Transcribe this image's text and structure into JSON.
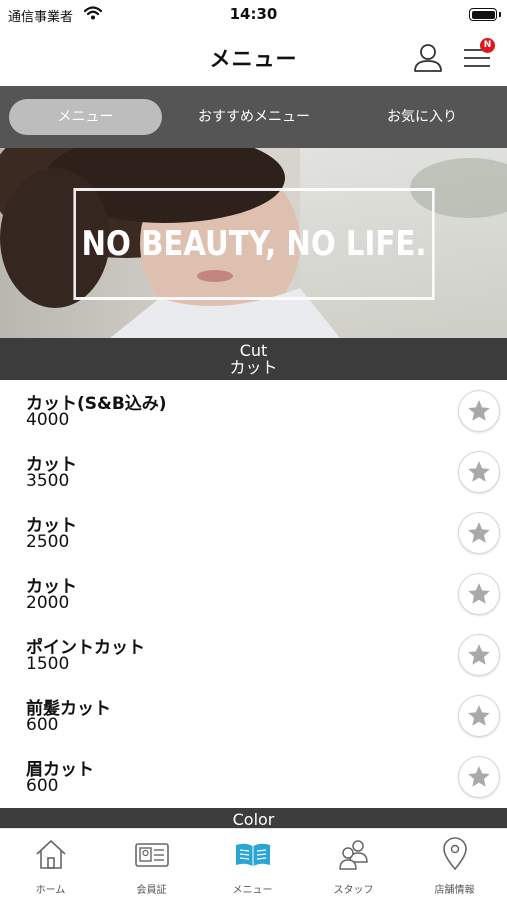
{
  "status_bar": {
    "carrier": "通信事業者",
    "time": "14:30"
  },
  "header": {
    "title": "メニュー",
    "notification_badge": "N",
    "icons": [
      "user-icon",
      "hamburger-menu-icon"
    ]
  },
  "tabs": [
    {
      "label": "メニュー",
      "active": true
    },
    {
      "label": "おすすめメニュー",
      "active": false
    },
    {
      "label": "お気に入り",
      "active": false
    }
  ],
  "banner": {
    "text": "NO BEAUTY, NO LIFE."
  },
  "sections": [
    {
      "title_en": "Cut",
      "title_ja": "カット",
      "items": [
        {
          "name": "カット(S&B込み)",
          "price": "4000"
        },
        {
          "name": "カット",
          "price": "3500"
        },
        {
          "name": "カット",
          "price": "2500"
        },
        {
          "name": "カット",
          "price": "2000"
        },
        {
          "name": "ポイントカット",
          "price": "1500"
        },
        {
          "name": "前髪カット",
          "price": "600"
        },
        {
          "name": "眉カット",
          "price": "600"
        }
      ]
    },
    {
      "title_en": "Color"
    }
  ],
  "bottom_nav": [
    {
      "label": "ホーム",
      "icon": "home-icon",
      "active": false
    },
    {
      "label": "会員証",
      "icon": "member-card-icon",
      "active": false
    },
    {
      "label": "メニュー",
      "icon": "book-icon",
      "active": true
    },
    {
      "label": "スタッフ",
      "icon": "staff-icon",
      "active": false
    },
    {
      "label": "店舗情報",
      "icon": "location-pin-icon",
      "active": false
    }
  ],
  "colors": {
    "tab_bar": "#555555",
    "section_header": "#3c3c3c",
    "active_nav": "#2aa6d5",
    "badge": "#e0161e",
    "star": "#a9a9a9"
  }
}
